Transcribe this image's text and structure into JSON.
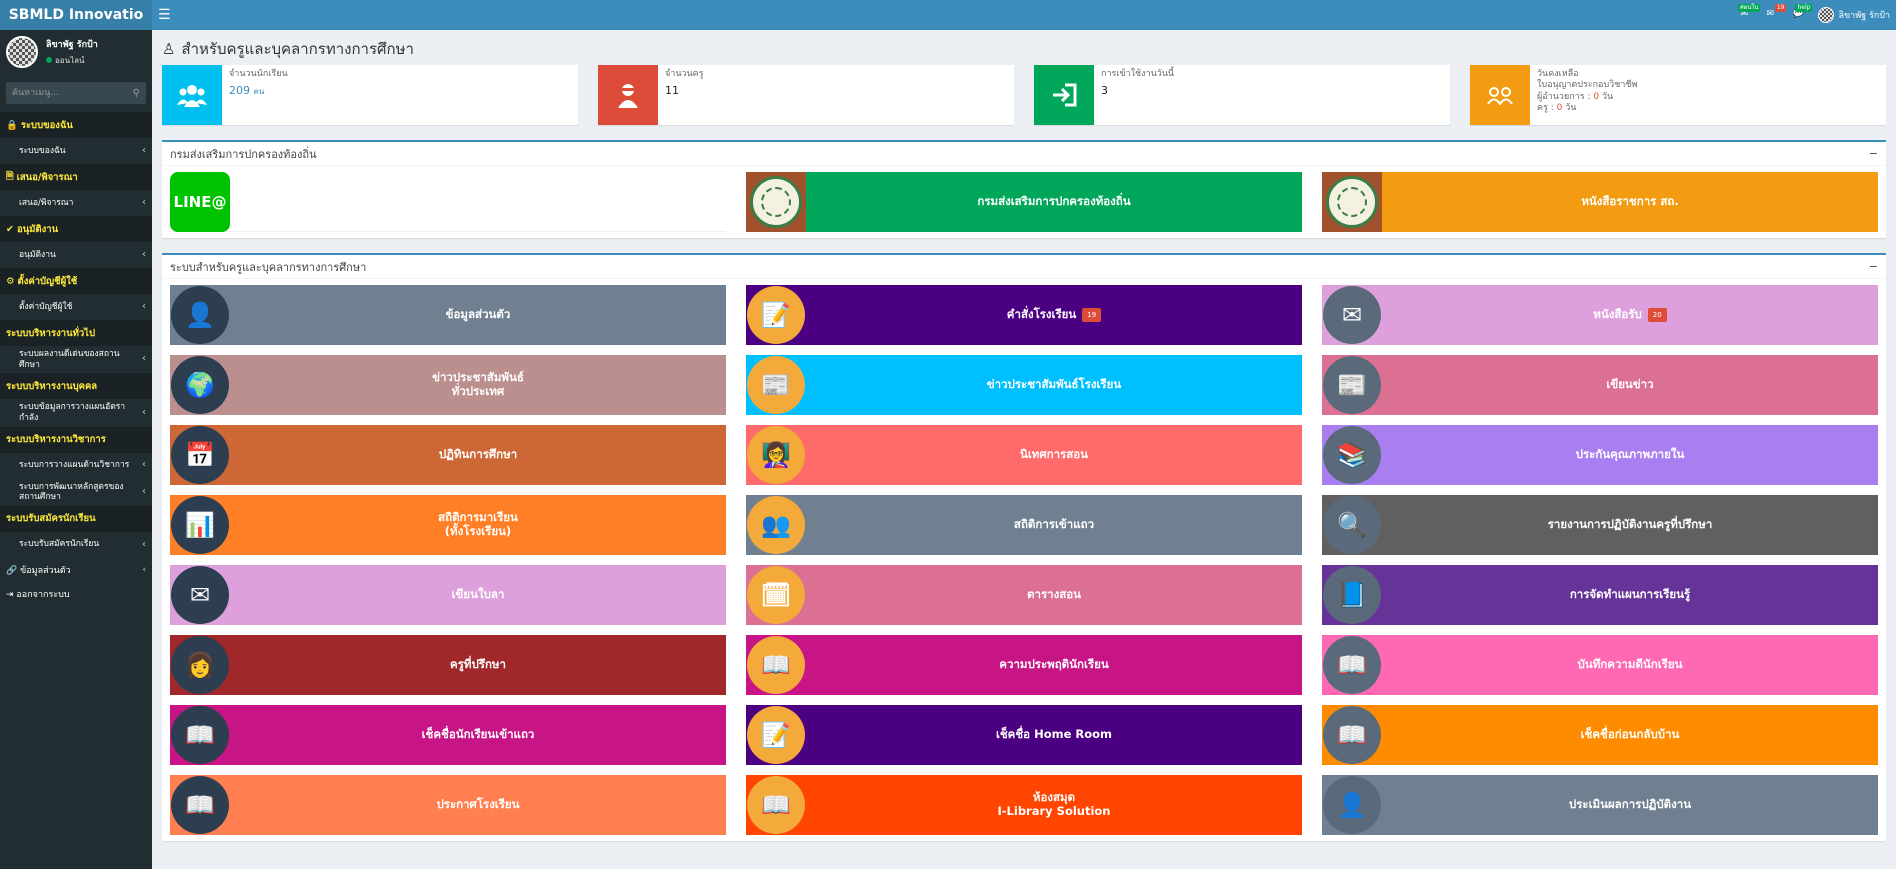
{
  "brand": "SBMLD Innovatio",
  "user": {
    "name": "ลิขาพัฐ รักป้า",
    "status": "ออนไลน์"
  },
  "search": {
    "placeholder": "ค้นหาเมนู..."
  },
  "sidebar": {
    "sections": [
      {
        "header": "ระบบของฉัน",
        "icon": "lock-icon",
        "items": [
          "ระบบของฉัน"
        ]
      },
      {
        "header": "เสนอ/พิจารณา",
        "icon": "document-icon",
        "items": [
          "เสนอ/พิจารณา"
        ]
      },
      {
        "header": "อนุมัติงาน",
        "icon": "check-icon",
        "items": [
          "อนุมัติงาน"
        ]
      },
      {
        "header": "ตั้งค่าบัญชีผู้ใช้",
        "icon": "gear-icon",
        "items": [
          "ตั้งค่าบัญชีผู้ใช้"
        ]
      },
      {
        "header": "ระบบบริหารงานทั่วไป",
        "icon": "",
        "items": [
          "ระบบผลงานดีเด่นของสถาน\nศึกษา"
        ]
      },
      {
        "header": "ระบบบริหารงานบุคคล",
        "icon": "",
        "items": [
          "ระบบข้อมูลการวางแผนอัตรา\nกำลัง"
        ]
      },
      {
        "header": "ระบบบริหารงานวิชาการ",
        "icon": "",
        "items": [
          "ระบบการวางแผนด้านวิชาการ",
          "ระบบการพัฒนาหลักสูตรของ\nสถานศึกษา"
        ]
      },
      {
        "header": "ระบบรับสมัครนักเรียน",
        "icon": "",
        "items": [
          "ระบบรับสมัครนักเรียน"
        ]
      }
    ],
    "plain": [
      {
        "label": "ข้อมูลส่วนตัว",
        "icon": "link-icon",
        "chevron": true
      },
      {
        "label": "ออกจากระบบ",
        "icon": "logout-icon",
        "chevron": false
      }
    ]
  },
  "topbar": {
    "badge_green": "ศผนใน",
    "badge_red": "19",
    "badge_green2": "help",
    "username": "ลิขาพัฐ รักป้า"
  },
  "page_title": "สำหรับครูและบุคลากรทางการศึกษา",
  "stats": [
    {
      "label": "จำนวนนักเรียน",
      "value": "209",
      "unit": "คน",
      "color": "#00c0ef",
      "icon": "users-icon"
    },
    {
      "label": "จำนวนครู",
      "value": "11",
      "unit": "",
      "color": "#dd4b39",
      "icon": "teacher-icon"
    },
    {
      "label": "การเข้าใช้งานวันนี้",
      "value": "3",
      "unit": "",
      "color": "#00a65a",
      "icon": "sign-in-icon"
    },
    {
      "label": "วันคงเหลือ",
      "line2": "ใบอนุญาตประกอบวิชาชีพ",
      "line3a": "ผู้อำนวยการ : ",
      "line3b": "0",
      "line3c": " วัน",
      "line4a": "ครู : ",
      "line4b": "0",
      "line4c": " วัน",
      "color": "#f39c12",
      "icon": "license-icon"
    }
  ],
  "box1": {
    "title": "กรมส่งเสริมการปกครองท้องถิ่น",
    "collapse": "−",
    "line_logo": "LINE@",
    "tiles": [
      {
        "label": "กรมส่งเสริมการปกครองท้องถิ่น",
        "color": "#00a65a",
        "icon": "seal-icon"
      },
      {
        "label": "หนังสือราชการ สถ.",
        "color": "#f39c12",
        "icon": "seal-icon"
      }
    ]
  },
  "box2": {
    "title": "ระบบสำหรับครูและบุคลากรทางการศึกษา",
    "collapse": "−",
    "tiles": [
      {
        "label": "ข้อมูลส่วนตัว",
        "color": "#708090",
        "icon": "person-icon",
        "glyph": "👤",
        "badge": ""
      },
      {
        "label": "คำสั่งโรงเรียน",
        "color": "#4b0082",
        "icon": "document-pen-icon",
        "glyph": "📝",
        "badge": "19"
      },
      {
        "label": "หนังสือรับ",
        "color": "#dda0dd",
        "icon": "envelope-icon",
        "glyph": "✉",
        "badge": "20"
      },
      {
        "label": "ข่าวประชาสัมพันธ์\nทั่วประเทศ",
        "color": "#bc8f8f",
        "icon": "world-map-icon",
        "glyph": "🌍",
        "badge": ""
      },
      {
        "label": "ข่าวประชาสัมพันธ์โรงเรียน",
        "color": "#00bfff",
        "icon": "breaking-news-icon",
        "glyph": "📰",
        "badge": ""
      },
      {
        "label": "เขียนข่าว",
        "color": "#db7093",
        "icon": "newspaper-icon",
        "glyph": "📰",
        "badge": ""
      },
      {
        "label": "ปฏิทินการศึกษา",
        "color": "#cd6836",
        "icon": "calendar-icon",
        "glyph": "📅",
        "badge": ""
      },
      {
        "label": "นิเทศการสอน",
        "color": "#ff6a6a",
        "icon": "teacher-board-icon",
        "glyph": "👩‍🏫",
        "badge": ""
      },
      {
        "label": "ประกันคุณภาพภายใน",
        "color": "#a97ef0",
        "icon": "binders-icon",
        "glyph": "📚",
        "badge": ""
      },
      {
        "label": "สถิติการมาเรียน\n(ทั้งโรงเรียน)",
        "color": "#ff7f27",
        "icon": "bar-chart-icon",
        "glyph": "📊",
        "badge": ""
      },
      {
        "label": "สถิติการเข้าแถว",
        "color": "#708090",
        "icon": "group-icon",
        "glyph": "👥",
        "badge": ""
      },
      {
        "label": "รายงานการปฏิบัติงานครูที่ปรึกษา",
        "color": "#606060",
        "icon": "report-search-icon",
        "glyph": "🔍",
        "badge": ""
      },
      {
        "label": "เขียนใบลา",
        "color": "#dda0dd",
        "icon": "envelope-icon",
        "glyph": "✉",
        "badge": ""
      },
      {
        "label": "ตารางสอน",
        "color": "#db7093",
        "icon": "schedule-icon",
        "glyph": "🗓",
        "badge": ""
      },
      {
        "label": "การจัดทำแผนการเรียนรู้",
        "color": "#663399",
        "icon": "book-icon",
        "glyph": "📘",
        "badge": ""
      },
      {
        "label": "ครูที่ปรึกษา",
        "color": "#a0282b",
        "icon": "woman-teacher-icon",
        "glyph": "👩",
        "badge": ""
      },
      {
        "label": "ความประพฤตินักเรียน",
        "color": "#c71585",
        "icon": "book-open-icon",
        "glyph": "📖",
        "badge": ""
      },
      {
        "label": "บันทึกความดีนักเรียน",
        "color": "#ff69b4",
        "icon": "book-open-icon",
        "glyph": "📖",
        "badge": ""
      },
      {
        "label": "เช็คชื่อนักเรียนเข้าแถว",
        "color": "#c71585",
        "icon": "book-open-icon",
        "glyph": "📖",
        "badge": ""
      },
      {
        "label": "เช็คชื่อ Home Room",
        "color": "#4b0082",
        "icon": "document-pen-icon",
        "glyph": "📝",
        "badge": ""
      },
      {
        "label": "เช็คชื่อก่อนกลับบ้าน",
        "color": "#ff8c00",
        "icon": "book-open-icon",
        "glyph": "📖",
        "badge": ""
      },
      {
        "label": "ประกาศโรงเรียน",
        "color": "#ff7f50",
        "icon": "book-open-icon",
        "glyph": "📖",
        "badge": ""
      },
      {
        "label": "ห้องสมุด\nI-Library Solution",
        "color": "#ff4500",
        "icon": "book-open-icon",
        "glyph": "📖",
        "badge": ""
      },
      {
        "label": "ประเมินผลการปฏิบัติงาน",
        "color": "#708090",
        "icon": "person-icon",
        "glyph": "👤",
        "badge": ""
      }
    ]
  }
}
